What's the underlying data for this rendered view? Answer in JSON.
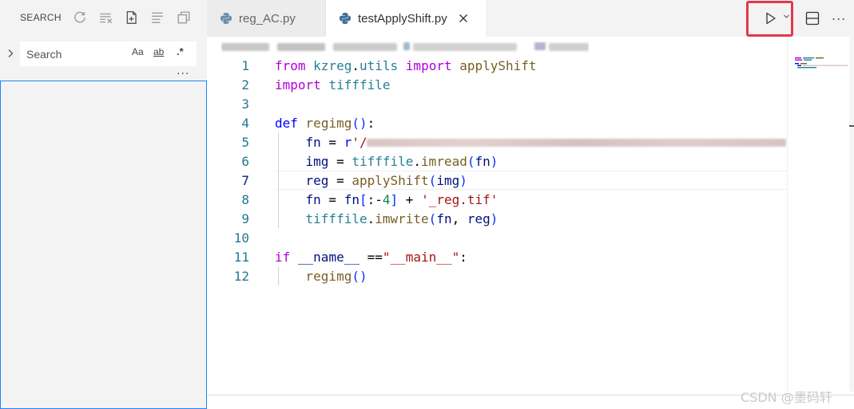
{
  "sidebar": {
    "title": "SEARCH",
    "actions": [
      "refresh-icon",
      "clear-results-icon",
      "new-search-editor-icon",
      "view-as-tree-icon",
      "collapse-all-icon"
    ],
    "search": {
      "placeholder": "Search",
      "value": "",
      "match_case": "Aa",
      "whole_word": "ab",
      "regex": ".*"
    },
    "more": "..."
  },
  "tabs": [
    {
      "label": "reg_AC.py",
      "active": false,
      "icon": "python-icon"
    },
    {
      "label": "testApplyShift.py",
      "active": true,
      "icon": "python-icon"
    }
  ],
  "toolbar": {
    "run": "play-icon",
    "run_dropdown": "chevron-down-icon",
    "split": "split-editor-icon",
    "more": "..."
  },
  "editor": {
    "current_line": 7,
    "line_numbers": [
      "1",
      "2",
      "3",
      "4",
      "5",
      "6",
      "7",
      "8",
      "9",
      "10",
      "11",
      "12"
    ],
    "lines": [
      "from kzreg.utils import applyShift",
      "import tifffile",
      "",
      "def regimg():",
      "    fn = r'/",
      "    img = tifffile.imread(fn)",
      "    reg = applyShift(img)",
      "    fn = fn[:-4] + '_reg.tif'",
      "    tifffile.imwrite(fn, reg)",
      "",
      "if __name__ ==\"__main__\":",
      "    regimg()"
    ]
  },
  "watermark": "CSDN @墨码轩",
  "colors": {
    "accent": "#1a85ff",
    "highlight_box": "#e0394c",
    "keyword": "#0000ff",
    "control_keyword": "#af00db",
    "function": "#795e26",
    "module": "#267f99",
    "string": "#a31515",
    "number": "#098658"
  }
}
